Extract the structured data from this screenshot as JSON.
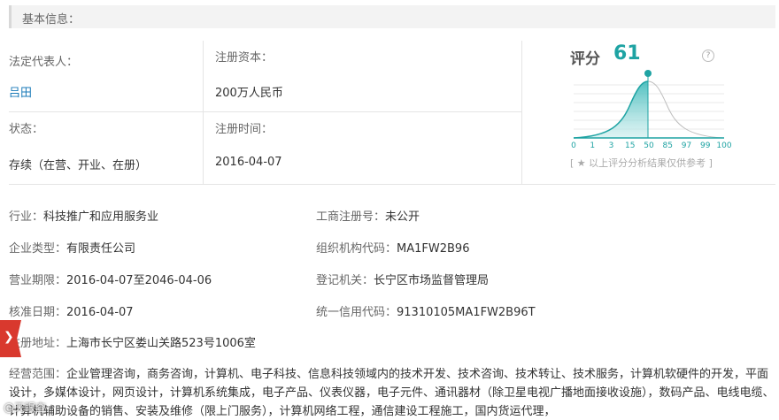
{
  "section": {
    "title": "基本信息："
  },
  "basic": {
    "legal_rep_label": "法定代表人：",
    "legal_rep_value": "吕田",
    "capital_label": "注册资本：",
    "capital_value": "200万人民币",
    "status_label": "状态：",
    "status_value": "存续（在营、开业、在册）",
    "reg_time_label": "注册时间：",
    "reg_time_value": "2016-04-07"
  },
  "score": {
    "label": "评分",
    "value": "61",
    "help": "?",
    "ticks": [
      "0",
      "1",
      "3",
      "15",
      "50",
      "85",
      "97",
      "99",
      "100"
    ],
    "note": "[ ★ 以上评分分析结果仅供参考 ]",
    "accent": "#1ea3a3"
  },
  "details": {
    "industry_label": "行业：",
    "industry_value": "科技推广和应用服务业",
    "biz_reg_label": "工商注册号：",
    "biz_reg_value": "未公开",
    "company_type_label": "企业类型：",
    "company_type_value": "有限责任公司",
    "org_code_label": "组织机构代码：",
    "org_code_value": "MA1FW2B96",
    "term_label": "营业期限：",
    "term_value": "2016-04-07至2046-04-06",
    "authority_label": "登记机关：",
    "authority_value": "长宁区市场监督管理局",
    "approval_label": "核准日期：",
    "approval_value": "2016-04-07",
    "credit_label": "统一信用代码：",
    "credit_value": "91310105MA1FW2B96T",
    "address_label": "注册地址：",
    "address_value": "上海市长宁区娄山关路523号1006室",
    "scope_label": "经营范围：",
    "scope_value": "企业管理咨询，商务咨询，计算机、电子科技、信息科技领域内的技术开发、技术咨询、技术转让、技术服务，计算机软硬件的开发，平面设计，多媒体设计，网页设计，计算机系统集成，电子产品、仪表仪器，电子元件、通讯器材（除卫星电视广播地面接收设施），数码产品、电线电缆、计算机辅助设备的销售、安装及维修（限上门服务），计算机网络工程，通信建设工程施工，国内货运代理，"
  },
  "badge": {
    "glyph": "❯"
  },
  "watermark": {
    "text": "@天眼查"
  }
}
